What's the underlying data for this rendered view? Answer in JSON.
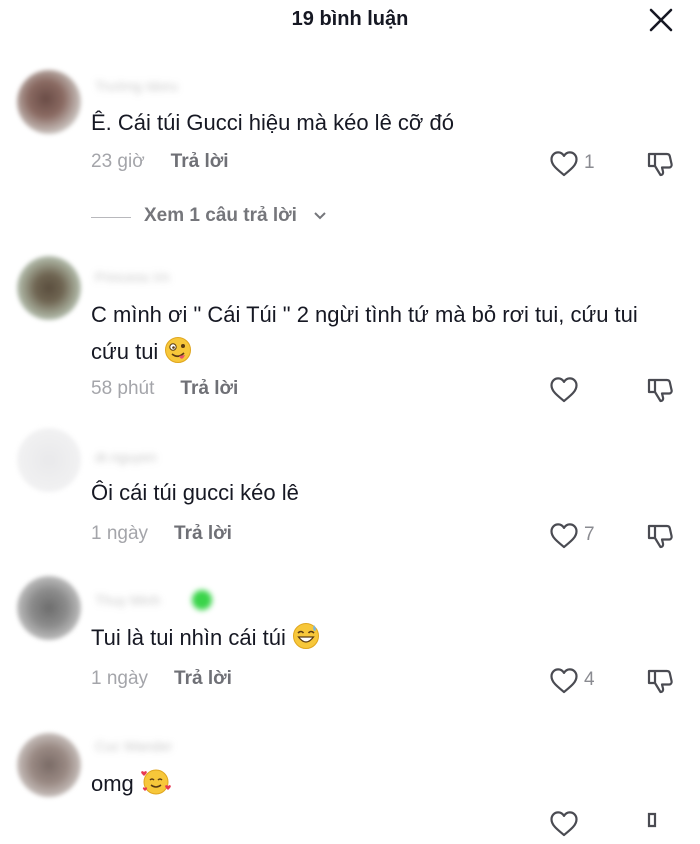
{
  "header": {
    "title": "19 bình luận",
    "close_icon": "close-icon"
  },
  "comments": [
    {
      "username": "Trường Idoru",
      "text": "Ê. Cái túi Gucci hiệu mà kéo lê cỡ đó",
      "time": "23 giờ",
      "reply": "Trả lời",
      "likes": "1",
      "view_replies": "Xem 1 câu trả lời"
    },
    {
      "username": "Princess.Vn",
      "text": "C mình ơi \" Cái Túi \" 2 ngừi tình tứ mà bỏ rơi tui, cứu tui cứu tui",
      "emoji": "zany-face",
      "time": "58 phút",
      "reply": "Trả lời",
      "likes": ""
    },
    {
      "username": "dr.nguyen",
      "text": "Ôi cái túi gucci kéo lê",
      "time": "1 ngày",
      "reply": "Trả lời",
      "likes": "7"
    },
    {
      "username": "Thuy Minh",
      "text": "Tui là tui nhìn cái túi",
      "emoji": "grinning-sweat-face",
      "time": "1 ngày",
      "reply": "Trả lời",
      "likes": "4"
    },
    {
      "username": "Cuc Wander",
      "text": "omg",
      "emoji": "smiling-face-with-hearts"
    }
  ],
  "colors": {
    "text": "#161823",
    "meta": "#8a8b91",
    "background": "#ffffff"
  }
}
